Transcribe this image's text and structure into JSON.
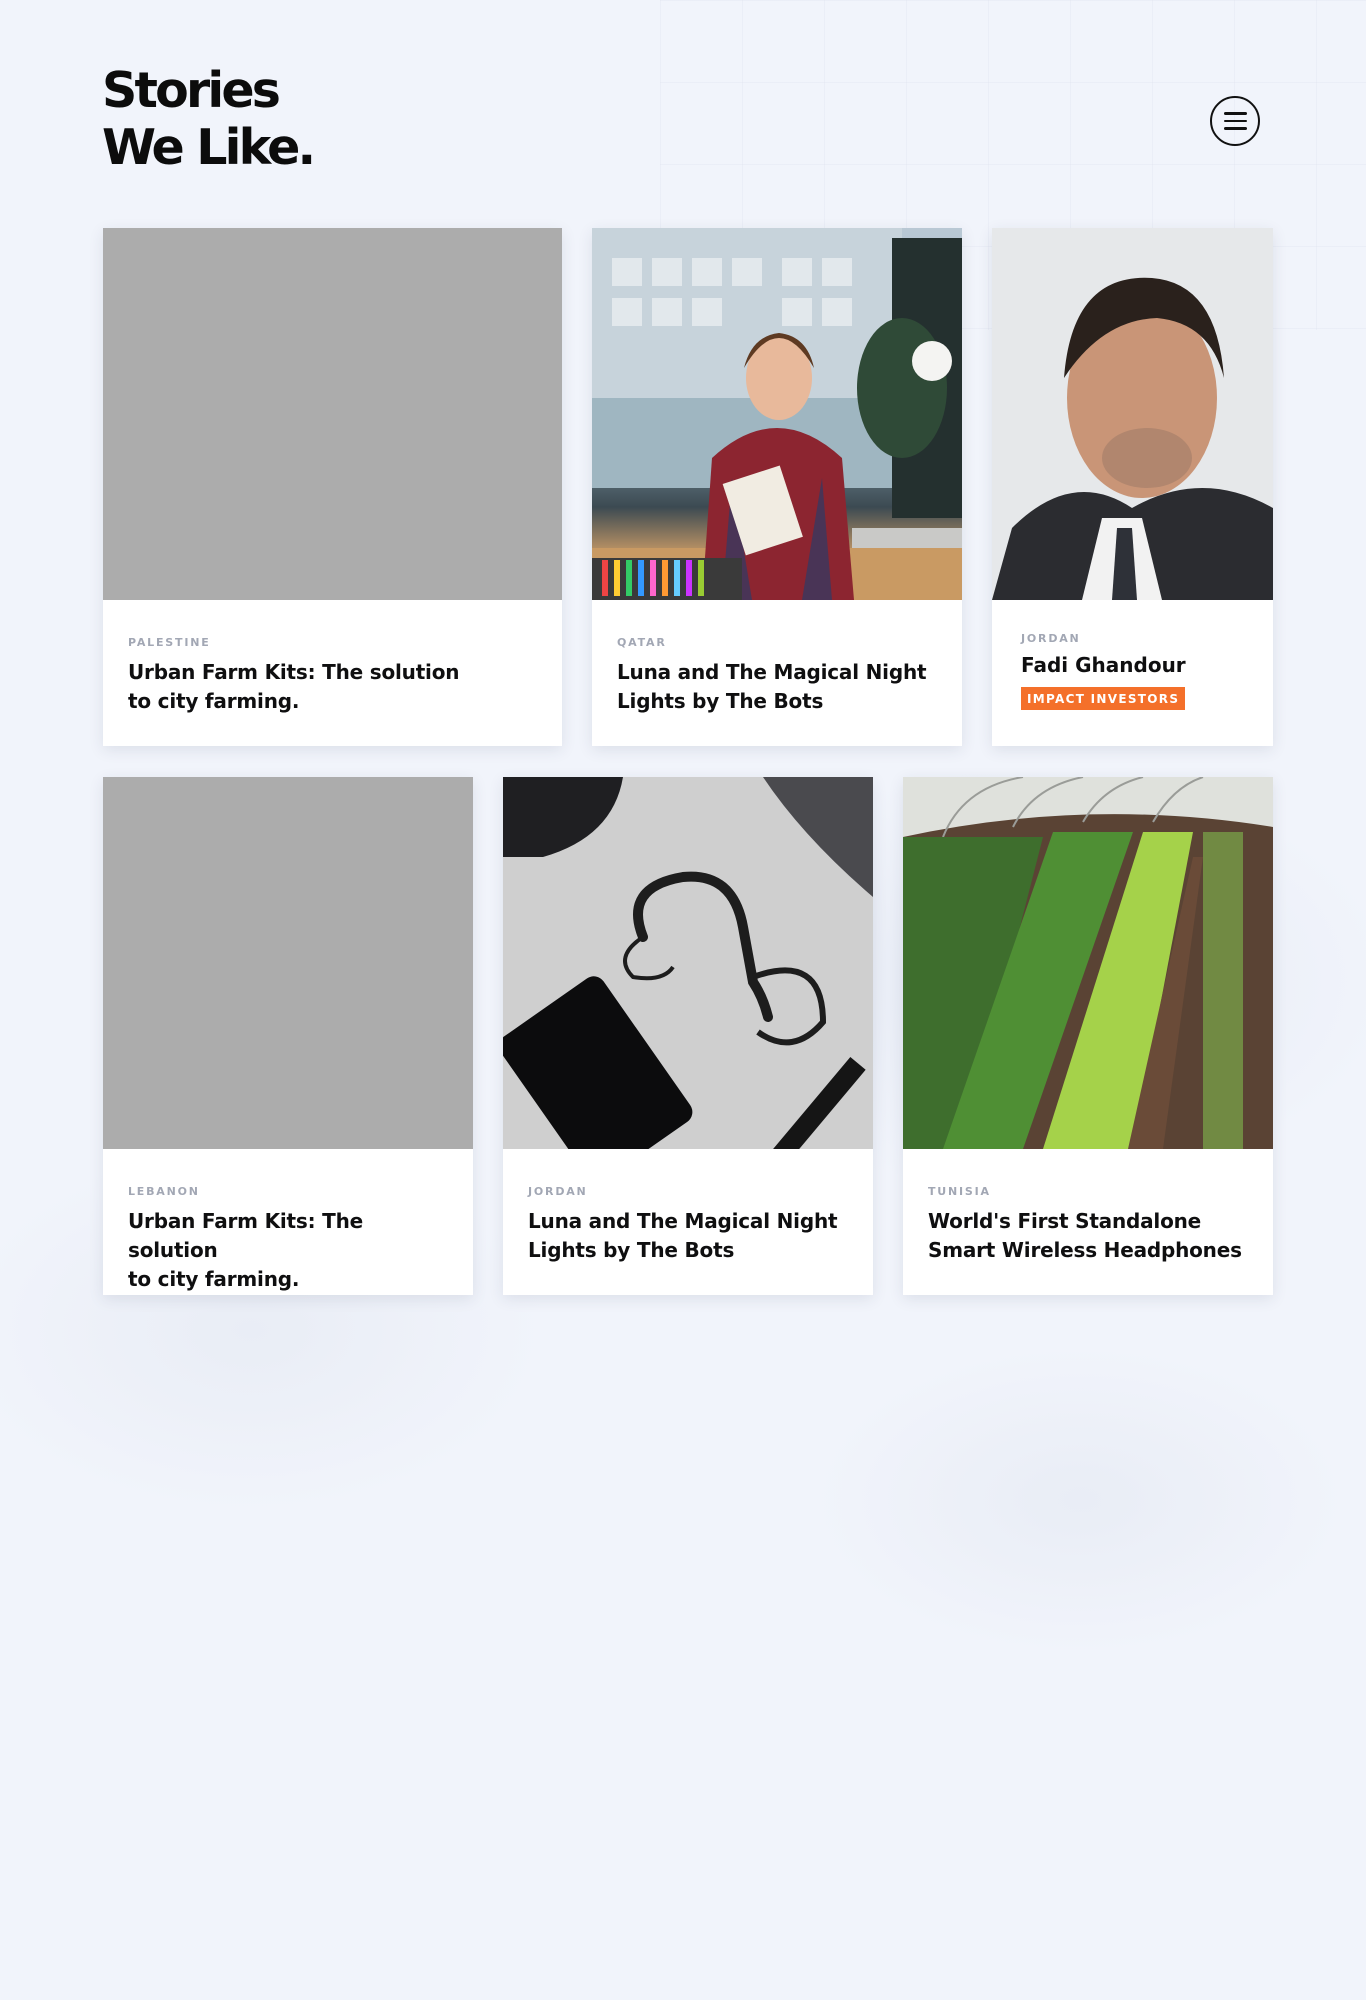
{
  "header": {
    "title_line1": "Stories",
    "title_line2": "We Like."
  },
  "menu": {
    "icon": "hamburger-menu-icon"
  },
  "cards": [
    {
      "country": "PALESTINE",
      "title_line1": "Urban Farm Kits: The solution",
      "title_line2": "to city farming."
    },
    {
      "country": "QATAR",
      "title_line1": "Luna and The Magical Night",
      "title_line2": "Lights by The Bots"
    },
    {
      "country": "JORDAN",
      "name": "Fadi Ghandour",
      "tag": "IMPACT INVESTORS"
    },
    {
      "country": "LEBANON",
      "title_line1": "Urban Farm Kits: The solution",
      "title_line2": "to city farming."
    },
    {
      "country": "JORDAN",
      "title_line1": "Luna and The Magical Night",
      "title_line2": "Lights by The Bots"
    },
    {
      "country": "TUNISIA",
      "title_line1": "World's First Standalone",
      "title_line2": "Smart Wireless Headphones"
    }
  ],
  "colors": {
    "accent": "#f4702a",
    "background": "#f1f4fb",
    "placeholder": "#acacac"
  }
}
